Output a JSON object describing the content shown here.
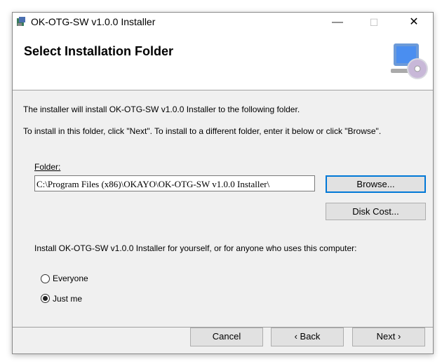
{
  "window": {
    "title": "OK-OTG-SW v1.0.0 Installer",
    "minimize": "—",
    "maximize": "☐",
    "close": "✕"
  },
  "header": {
    "title": "Select Installation Folder"
  },
  "body": {
    "line1": "The installer will install OK-OTG-SW v1.0.0 Installer to the following folder.",
    "line2": "To install in this folder, click \"Next\". To install to a different folder, enter it below or click \"Browse\".",
    "folder_label": "Folder:",
    "folder_value": "C:\\Program Files (x86)\\OKAYO\\OK-OTG-SW v1.0.0 Installer\\",
    "browse": "Browse...",
    "disk_cost": "Disk Cost...",
    "scope_prompt": "Install OK-OTG-SW v1.0.0 Installer for yourself, or for anyone who uses this computer:",
    "options": [
      {
        "label": "Everyone",
        "selected": false
      },
      {
        "label": "Just me",
        "selected": true
      }
    ]
  },
  "footer": {
    "cancel": "Cancel",
    "back": "‹ Back",
    "next": "Next ›"
  }
}
